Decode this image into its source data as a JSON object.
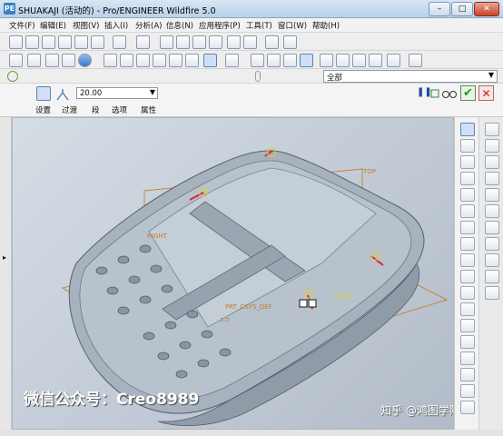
{
  "window": {
    "title": "SHUAKAJI (活动的) - Pro/ENGINEER Wildfire 5.0",
    "app_icon": "PE",
    "buttons": {
      "minimize": "–",
      "maximize": "□",
      "close": "✕"
    }
  },
  "menu": {
    "items": [
      "文件(F)",
      "编辑(E)",
      "视图(V)",
      "插入(I)",
      "分析(A)",
      "信息(N)",
      "应用程序(P)",
      "工具(T)",
      "窗口(W)",
      "帮助(H)"
    ]
  },
  "filter": {
    "selected": "全部"
  },
  "dashboard": {
    "value": "20.00",
    "tabs": [
      "设置",
      "过渡",
      "段",
      "选项",
      "属性"
    ],
    "pause_symbol": "❚❚",
    "accept_symbol": "✔",
    "cancel_symbol": "✕"
  },
  "model": {
    "labels": {
      "top": "TOP",
      "right": "RIGHT",
      "csys": "PRT_CSYS_DEF",
      "front": "F-T",
      "radius": "20.00"
    }
  },
  "watermark": {
    "left": "微信公众号：Creo8989",
    "right": "知乎 @鸿图学院"
  },
  "colors": {
    "accent": "#3b78c7",
    "datum_orange": "#c87a2a",
    "selection_red": "#e0203a",
    "part_gray": "#a6b2bd"
  }
}
